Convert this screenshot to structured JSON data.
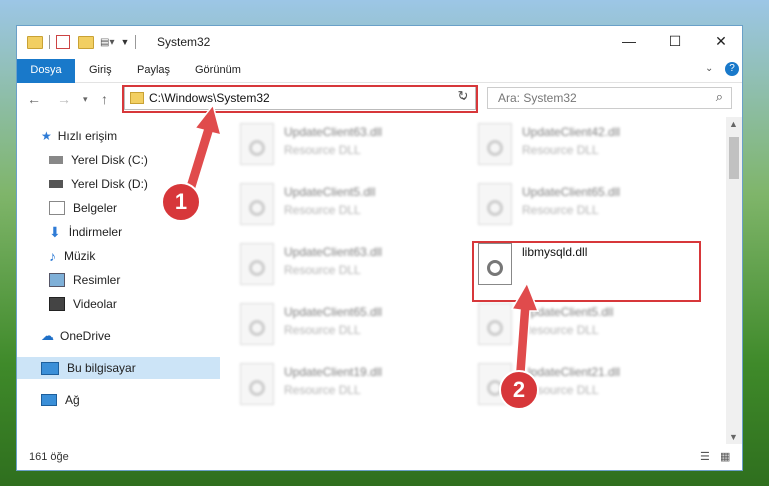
{
  "window": {
    "title": "System32"
  },
  "ribbon": {
    "tabs": [
      "Dosya",
      "Giriş",
      "Paylaş",
      "Görünüm"
    ]
  },
  "address": {
    "path": "C:\\Windows\\System32"
  },
  "search": {
    "placeholder": "Ara: System32"
  },
  "sidebar": {
    "items": [
      {
        "label": "Hızlı erişim",
        "icon": "star-icon"
      },
      {
        "label": "Yerel Disk (C:)",
        "icon": "disk-icon"
      },
      {
        "label": "Yerel Disk (D:)",
        "icon": "disk-icon"
      },
      {
        "label": "Belgeler",
        "icon": "document-icon"
      },
      {
        "label": "İndirmeler",
        "icon": "download-icon"
      },
      {
        "label": "Müzik",
        "icon": "music-icon"
      },
      {
        "label": "Resimler",
        "icon": "picture-icon"
      },
      {
        "label": "Videolar",
        "icon": "video-icon"
      },
      {
        "label": "OneDrive",
        "icon": "cloud-icon"
      },
      {
        "label": "Bu bilgisayar",
        "icon": "computer-icon"
      },
      {
        "label": "Ağ",
        "icon": "network-icon"
      }
    ]
  },
  "files": [
    {
      "name": "UpdateClient63.dll",
      "type": "Resource DLL"
    },
    {
      "name": "UpdateClient42.dll",
      "type": "Resource DLL"
    },
    {
      "name": "UpdateClient5.dll",
      "type": "Resource DLL"
    },
    {
      "name": "UpdateClient65.dll",
      "type": "Resource DLL"
    },
    {
      "name": "UpdateClient63.dll",
      "type": "Resource DLL"
    },
    {
      "name": "libmysqld.dll",
      "type": ""
    },
    {
      "name": "UpdateClient65.dll",
      "type": "Resource DLL"
    },
    {
      "name": "UpdateClient5.dll",
      "type": "Resource DLL"
    },
    {
      "name": "UpdateClient19.dll",
      "type": "Resource DLL"
    },
    {
      "name": "UpdateClient21.dll",
      "type": "Resource DLL"
    }
  ],
  "status": {
    "count": "161 öğe"
  },
  "annotations": {
    "step1": "1",
    "step2": "2"
  },
  "colors": {
    "accent": "#1979ca",
    "highlight": "#d7373a"
  }
}
